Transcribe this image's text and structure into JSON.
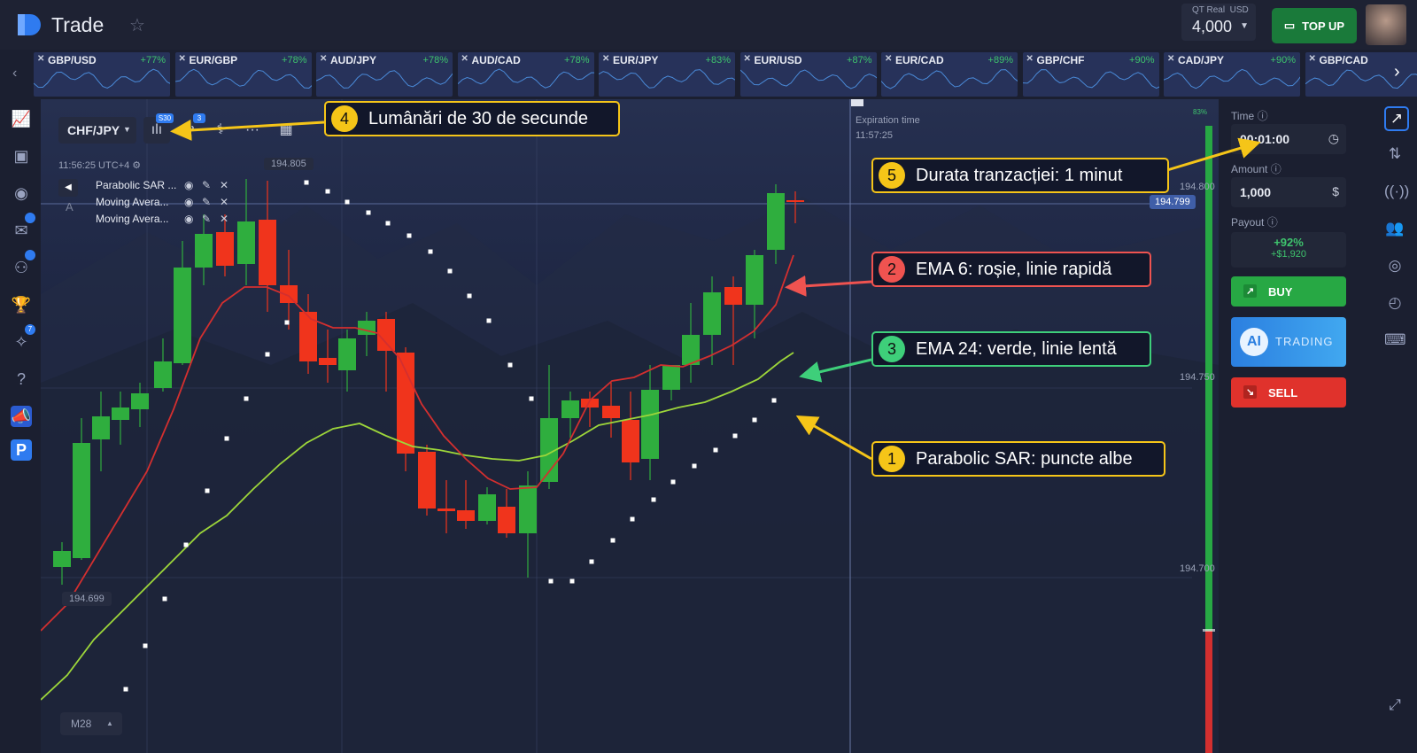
{
  "header": {
    "logo_text": "Trade",
    "account_type": "QT Real",
    "currency": "USD",
    "balance": "4,000",
    "topup_label": "TOP UP"
  },
  "tickers": [
    {
      "pair": "GBP/USD",
      "payout": "+77%"
    },
    {
      "pair": "EUR/GBP",
      "payout": "+78%"
    },
    {
      "pair": "AUD/JPY",
      "payout": "+78%"
    },
    {
      "pair": "AUD/CAD",
      "payout": "+78%"
    },
    {
      "pair": "EUR/JPY",
      "payout": "+83%"
    },
    {
      "pair": "EUR/USD",
      "payout": "+87%"
    },
    {
      "pair": "EUR/CAD",
      "payout": "+89%"
    },
    {
      "pair": "GBP/CHF",
      "payout": "+90%"
    },
    {
      "pair": "CAD/JPY",
      "payout": "+90%"
    },
    {
      "pair": "GBP/CAD",
      "payout": ""
    }
  ],
  "leftnav": {
    "badges": [
      "7"
    ]
  },
  "chart": {
    "symbol": "CHF/JPY",
    "timeframe_badge": "S30",
    "indicator_badge": "3",
    "clock": "11:56:25 UTC+4",
    "price_top_label": "194.805",
    "price_bottom_label": "194.699",
    "current_price": "194.799",
    "axis_labels": [
      "194.800",
      "194.750",
      "194.700"
    ],
    "expiration_label": "Expiration time",
    "expiration_time": "11:57:25",
    "indicators": [
      "Parabolic SAR ...",
      "Moving Avera...",
      "Moving Avera..."
    ],
    "zoom_label": "M28",
    "progress_pct": "83%"
  },
  "trade_panel": {
    "time_label": "Time",
    "time_value": "00:01:00",
    "amount_label": "Amount",
    "amount_value": "1,000",
    "payout_label": "Payout",
    "payout_pct": "+92%",
    "payout_amount": "+$1,920",
    "buy_label": "BUY",
    "ai_label": "AI",
    "ai_trading_label": "TRADING",
    "sell_label": "SELL"
  },
  "callouts": [
    {
      "num": "4",
      "text": "Lumânări de 30 de secunde",
      "color": "#f5c518"
    },
    {
      "num": "5",
      "text": "Durata tranzacției: 1 minut",
      "color": "#f5c518"
    },
    {
      "num": "2",
      "text": "EMA 6: roșie, linie rapidă",
      "color": "#ef5350"
    },
    {
      "num": "3",
      "text": "EMA 24: verde, linie lentă",
      "color": "#3ecf7a"
    },
    {
      "num": "1",
      "text": "Parabolic SAR: puncte albe",
      "color": "#f5c518"
    }
  ]
}
